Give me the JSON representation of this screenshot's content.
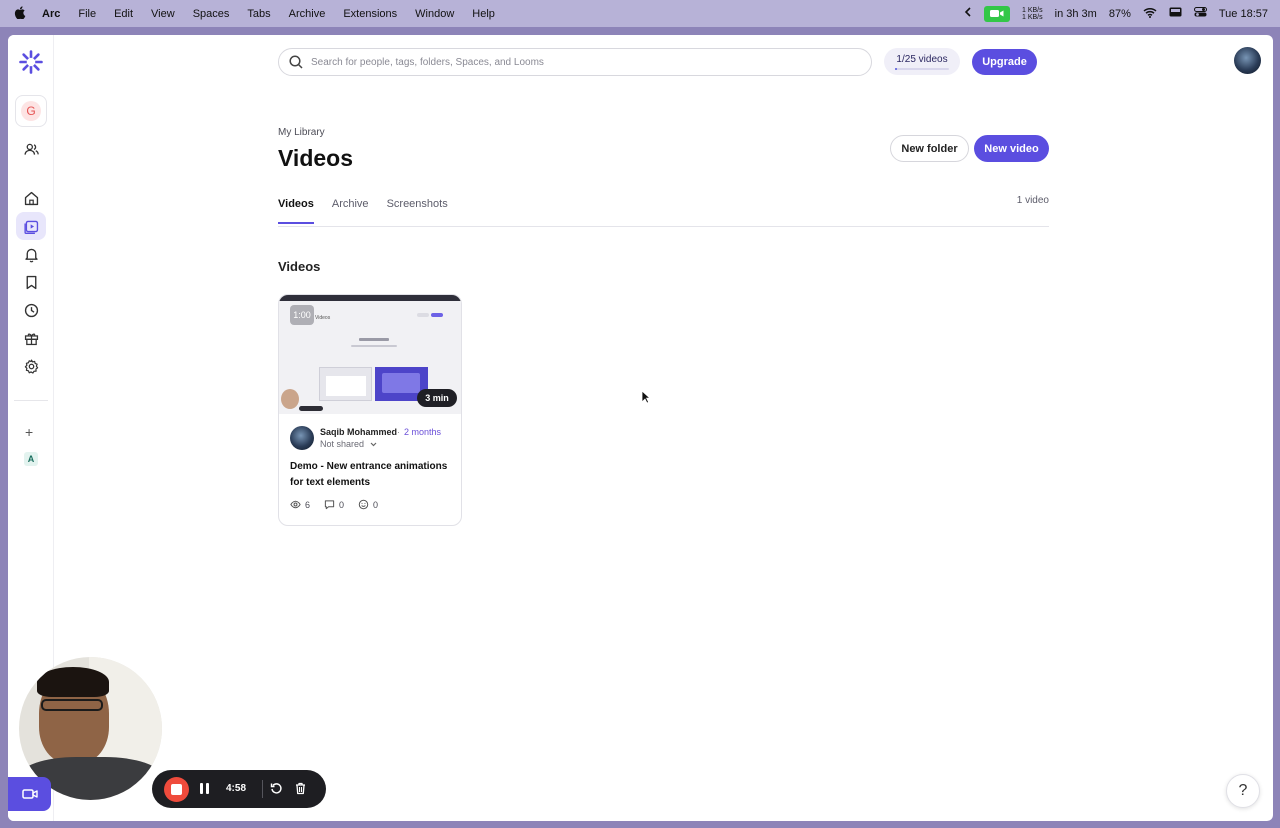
{
  "menubar": {
    "apple": "",
    "app": "Arc",
    "items": [
      "File",
      "Edit",
      "View",
      "Spaces",
      "Tabs",
      "Archive",
      "Extensions",
      "Window",
      "Help"
    ],
    "net_up": "1 KB/s",
    "net_down": "1 KB/s",
    "battery_time": "in 3h 3m",
    "battery_pct": "87%",
    "clock": "Tue 18:57"
  },
  "sidebar": {
    "workspace_initial": "G",
    "space_initial": "A",
    "add": "+"
  },
  "topbar": {
    "search_placeholder": "Search for people, tags, folders, Spaces, and Looms",
    "quota": "1/25 videos",
    "quota_fraction": 0.04,
    "upgrade": "Upgrade"
  },
  "header": {
    "breadcrumb": "My Library",
    "title": "Videos",
    "new_folder": "New folder",
    "new_video": "New video"
  },
  "tabs": [
    "Videos",
    "Archive",
    "Screenshots"
  ],
  "video_count": "1 video",
  "section_title": "Videos",
  "card": {
    "timestamp": "1:00",
    "duration": "3 min",
    "thumb_heading": "Videos",
    "author": "Saqib Mohammed",
    "separator": "·",
    "age": "2 months",
    "sharing": "Not shared",
    "title": "Demo - New entrance animations for text elements",
    "views": "6",
    "comments": "0",
    "reactions": "0"
  },
  "recorder": {
    "elapsed": "4:58"
  },
  "help": "?",
  "colors": {
    "accent": "#5b4ee0",
    "record": "#ef4b3c",
    "background": "#8d84b8"
  }
}
